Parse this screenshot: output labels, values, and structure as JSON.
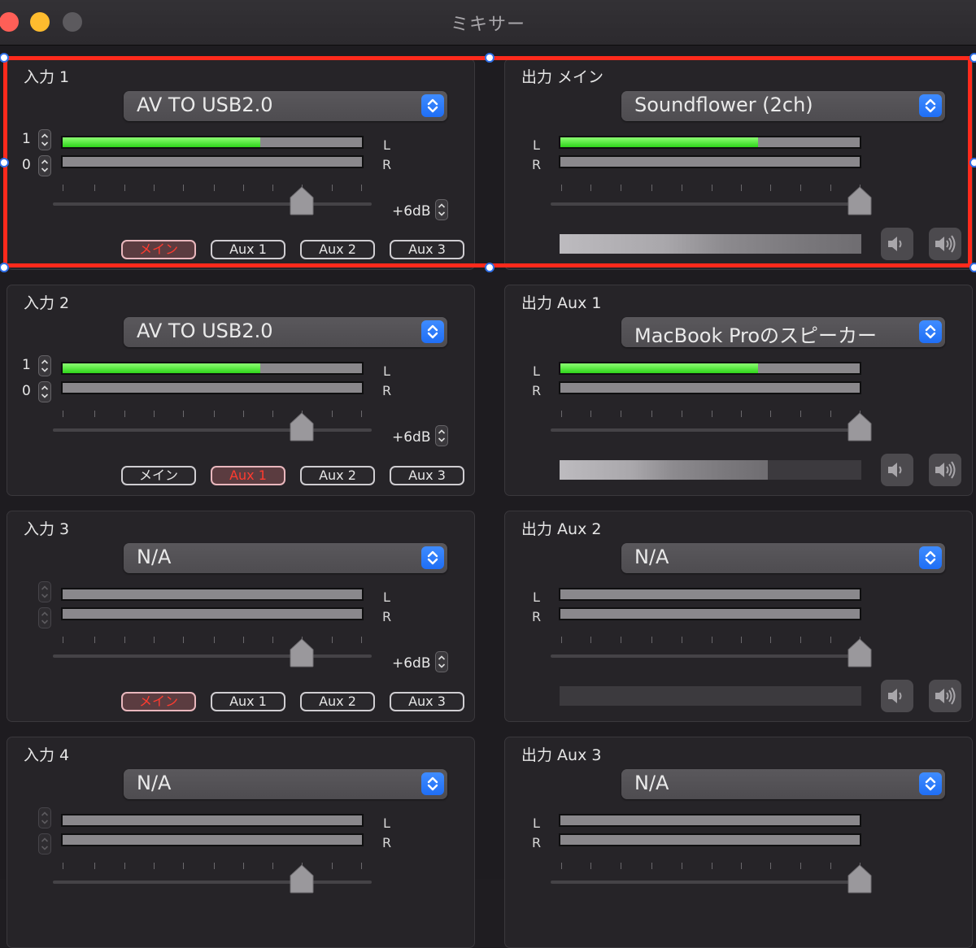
{
  "window": {
    "title": "ミキサー"
  },
  "inputs": [
    {
      "title": "入力 1",
      "device": "AV TO USB2.0",
      "step_top": "1",
      "step_bottom": "0",
      "meter_l": 0.66,
      "meter_r": 0.0,
      "gain_label": "+6dB",
      "fader": 0.78,
      "routes": [
        "メイン",
        "Aux 1",
        "Aux 2",
        "Aux 3"
      ],
      "active_route": 0
    },
    {
      "title": "入力 2",
      "device": "AV TO USB2.0",
      "step_top": "1",
      "step_bottom": "0",
      "meter_l": 0.66,
      "meter_r": 0.0,
      "gain_label": "+6dB",
      "fader": 0.78,
      "routes": [
        "メイン",
        "Aux 1",
        "Aux 2",
        "Aux 3"
      ],
      "active_route": 1
    },
    {
      "title": "入力 3",
      "device": "N/A",
      "step_top": "",
      "step_bottom": "",
      "meter_l": 0.0,
      "meter_r": 0.0,
      "gain_label": "+6dB",
      "fader": 0.78,
      "routes": [
        "メイン",
        "Aux 1",
        "Aux 2",
        "Aux 3"
      ],
      "active_route": 0
    },
    {
      "title": "入力 4",
      "device": "N/A",
      "step_top": "",
      "step_bottom": "",
      "meter_l": 0.0,
      "meter_r": 0.0,
      "gain_label": "",
      "fader": 0.78,
      "routes": [],
      "active_route": -1
    }
  ],
  "outputs": [
    {
      "title": "出力 メイン",
      "device": "Soundflower (2ch)",
      "meter_l": 0.66,
      "meter_r": 0.0,
      "fader": 1.0,
      "level": 1.0
    },
    {
      "title": "出力 Aux 1",
      "device": "MacBook Proのスピーカー",
      "meter_l": 0.66,
      "meter_r": 0.0,
      "fader": 1.0,
      "level": 0.69
    },
    {
      "title": "出力 Aux 2",
      "device": "N/A",
      "meter_l": 0.0,
      "meter_r": 0.0,
      "fader": 1.0,
      "level": 0.0
    },
    {
      "title": "出力 Aux 3",
      "device": "N/A",
      "meter_l": 0.0,
      "meter_r": 0.0,
      "fader": 1.0,
      "level": 0.0
    }
  ],
  "channel_labels": {
    "left": "L",
    "right": "R"
  },
  "icons": {
    "volume_low": "speaker-low-icon",
    "volume_high": "speaker-high-icon",
    "popup": "chevron-updown-icon"
  },
  "colors": {
    "selection": "#ff2a1c",
    "meter_green": "#2ed41a",
    "accent_blue": "#1f6ef5",
    "active_route_text": "#ff3b2f"
  }
}
